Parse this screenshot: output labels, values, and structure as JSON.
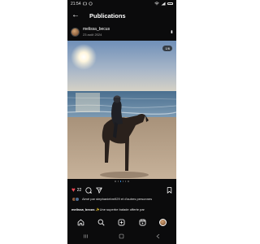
{
  "status_bar": {
    "time": "21:54",
    "battery": "battery-icon"
  },
  "header": {
    "back_icon": "arrow-left-icon",
    "title": "Publications"
  },
  "post": {
    "author": "melissa_becus",
    "date": "23 août 2024",
    "counter": "1/6",
    "likes": "22",
    "liked_by": "Aimé par stephaniebm929 et d'autres personnes",
    "caption_author": "melissa_becus",
    "caption_text": "✨Une superbe balade offerte par",
    "carousel_total": 6,
    "carousel_active": 3
  },
  "icons": {
    "like": "heart-icon",
    "comment": "comment-icon",
    "share": "send-icon",
    "save": "bookmark-icon",
    "more": "more-icon"
  },
  "bottom_nav": [
    "home-icon",
    "search-icon",
    "create-icon",
    "reels-icon",
    "profile-avatar"
  ],
  "system_nav": [
    "menu-icon",
    "home-square-icon",
    "back-icon"
  ],
  "colors": {
    "background": "#0b0b0c",
    "like": "#ed4956",
    "accent": "#3897f0"
  }
}
